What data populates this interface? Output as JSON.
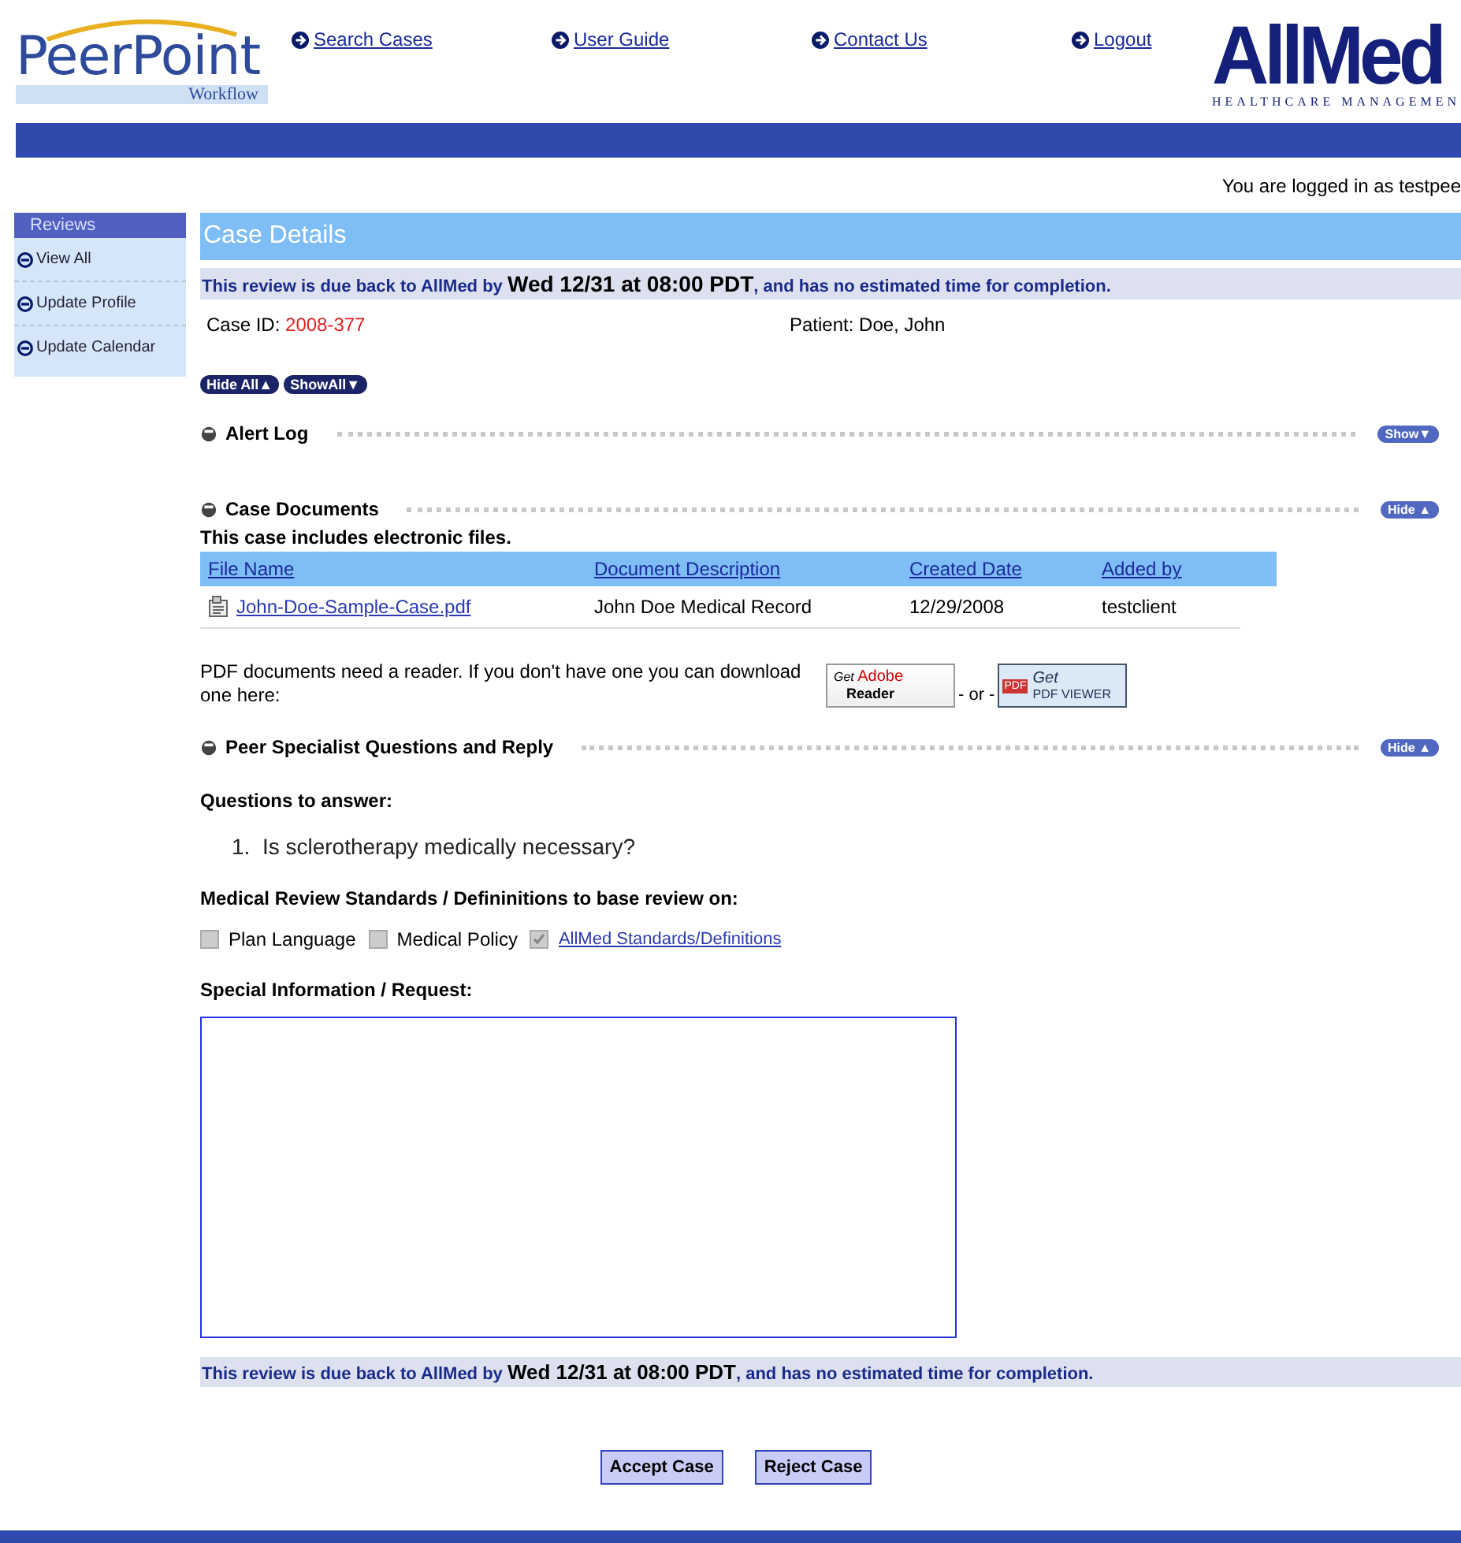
{
  "header": {
    "logo": {
      "name": "PeerPoint",
      "sub": "Workflow"
    },
    "nav": [
      "Search Cases",
      "User Guide",
      "Contact Us",
      "Logout"
    ],
    "brand": {
      "name": "AllMed",
      "sub": "HEALTHCARE MANAGEMEN"
    }
  },
  "login_text": "You are logged in as testpee",
  "sidebar": {
    "title": "Reviews",
    "items": [
      "View All",
      "Update Profile",
      "Update Calendar"
    ]
  },
  "page_title": "Case Details",
  "due_banners": [
    {
      "prefix": "This review is due back to AllMed by",
      "date": "Wed 12/31 at 08:00 PDT",
      "suffix": ", and has no estimated time for completion."
    },
    {
      "prefix": "This review is due back to AllMed by",
      "date": "Wed 12/31 at 08:00 PDT",
      "suffix": ", and has no estimated time for completion."
    }
  ],
  "case": {
    "id_label": "Case ID:",
    "id": "2008-377",
    "patient_label": "Patient:",
    "patient": "Doe, John"
  },
  "global_toggles": [
    "Hide All▲",
    "ShowAll▼"
  ],
  "sections": [
    {
      "kind": "alerts",
      "title": "Alert Log",
      "toggle": "Show▼"
    },
    {
      "kind": "documents",
      "title": "Case Documents",
      "toggle": "Hide ▲"
    },
    {
      "kind": "questions",
      "title": "Peer Specialist Questions and Reply",
      "toggle": "Hide ▲"
    }
  ],
  "documents": {
    "intro": "This case includes electronic files.",
    "columns": [
      "File Name",
      "Document Description",
      "Created Date",
      "Added by",
      ""
    ],
    "rows": [
      {
        "file": "John-Doe-Sample-Case.pdf",
        "description": "John Doe Medical Record",
        "created": "12/29/2008",
        "added_by": "testclient"
      }
    ],
    "reader_note": "PDF documents need a reader. If you don't have one you can download one here:",
    "adobe": {
      "get": "Get",
      "brand": "Adobe",
      "product": "Reader"
    },
    "separator": "- or -",
    "viewer": {
      "get": "Get",
      "badge": "PDF",
      "product": "PDF VIEWER"
    }
  },
  "questions": {
    "heading": "Questions to answer:",
    "items": [
      {
        "number": "1.",
        "text": "Is sclerotherapy medically necessary?"
      }
    ],
    "standards_heading": "Medical Review Standards / Defininitions to base review on:",
    "standards": [
      {
        "label": "Plan Language",
        "checked": false,
        "link": false
      },
      {
        "label": "Medical Policy",
        "checked": false,
        "link": false
      },
      {
        "label": "AllMed Standards/Definitions",
        "checked": true,
        "link": true
      }
    ],
    "special_heading": "Special Information / Request:"
  },
  "buttons": [
    "Accept Case",
    "Reject Case"
  ]
}
